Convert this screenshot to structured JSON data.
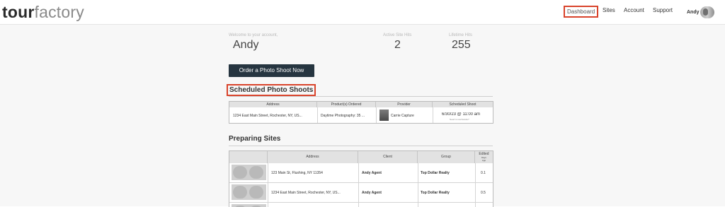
{
  "header": {
    "logo_bold": "tour",
    "logo_light": "factory",
    "nav": [
      "Dashboard",
      "Sites",
      "Account",
      "Support"
    ],
    "user_name": "Andy"
  },
  "welcome": {
    "label": "Welcome to your account,",
    "name": "Andy"
  },
  "stats": {
    "active_label": "Active Site Hits",
    "active_value": "2",
    "lifetime_label": "Lifetime Hits",
    "lifetime_value": "255"
  },
  "order_button": "Order a Photo Shoot Now",
  "scheduled": {
    "title": "Scheduled Photo Shoots",
    "columns": [
      "Address",
      "Product(s) Ordered",
      "Provider",
      "Scheduled Shoot"
    ],
    "rows": [
      {
        "address": "1234 East Main Street, Rochester, NY, US...",
        "product": "Daytime Photography: 35 ...",
        "provider": "Carrie Capture",
        "shoot": "6/30/23 @ 11:00 am",
        "reschedule": "Need to reschedule?"
      }
    ]
  },
  "preparing": {
    "title": "Preparing Sites",
    "columns": [
      "",
      "Address",
      "Client",
      "Group",
      "Edited",
      "Days",
      "Ago"
    ],
    "rows": [
      {
        "address": "123 Main St, Flushing, NY 11354",
        "client": "Andy Agent",
        "group": "Top Dollar Realty",
        "edited": "0.1"
      },
      {
        "address": "1234 East Main Street, Rochester, NY, US...",
        "client": "Andy Agent",
        "group": "Top Dollar Realty",
        "edited": "0.5"
      }
    ]
  },
  "colors": {
    "highlight": "#d9432b",
    "button_bg": "#263540"
  }
}
